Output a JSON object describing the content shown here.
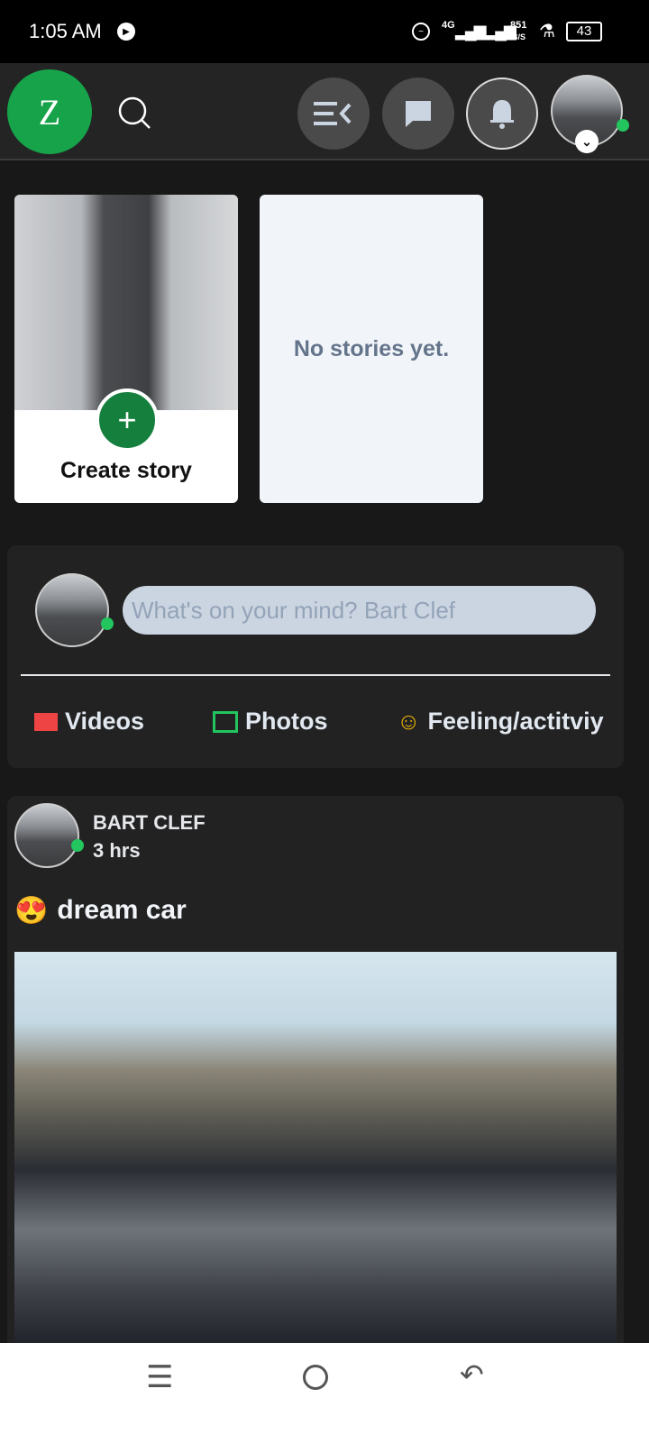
{
  "status_bar": {
    "time": "1:05 AM",
    "network": "4G",
    "speed_value": "851",
    "speed_unit": "B/S",
    "battery": "43"
  },
  "header": {
    "logo_letter": "Z"
  },
  "stories": {
    "create_label": "Create story",
    "empty_text": "No stories yet."
  },
  "composer": {
    "placeholder": "What's on your mind? Bart Clef",
    "actions": [
      {
        "label": "Videos",
        "color": "#ef4444"
      },
      {
        "label": "Photos",
        "color": "#22c55e"
      },
      {
        "label": "Feeling/actitviy",
        "color": "#eab308"
      }
    ]
  },
  "post": {
    "author": "BART CLEF",
    "time": "3 hrs",
    "emoji": "😍",
    "text": "dream car"
  },
  "colors": {
    "accent": "#16a34a",
    "online": "#22c55e"
  }
}
